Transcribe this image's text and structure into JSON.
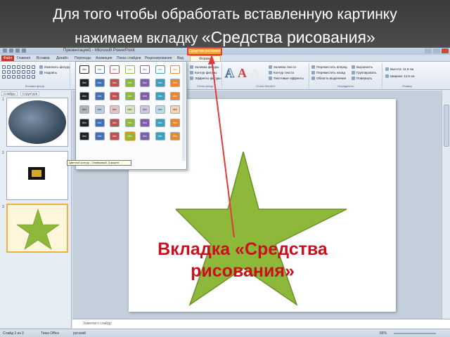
{
  "caption": {
    "line1": "Для того чтобы обработать  вставленную картинку",
    "line2_prefix": "нажимаем вкладку ",
    "line2_tab": "«Средства рисования»"
  },
  "titlebar": {
    "doc_title": "Презентация1 - Microsoft PowerPoint",
    "context_tab_head": "Средства рисования"
  },
  "ribbon_tabs": {
    "file": "Файл",
    "tabs": [
      "Главная",
      "Вставка",
      "Дизайн",
      "Переходы",
      "Анимация",
      "Показ слайдов",
      "Рецензирование",
      "Вид"
    ],
    "active": "Формат"
  },
  "ribbon": {
    "groups": {
      "insert_shapes": "Вставка фигур",
      "shape_styles": "Стили фигур",
      "wordart_styles": "Стили WordArt",
      "arrange": "Упорядочить",
      "size": "Размер"
    },
    "items": {
      "change_shape": "Изменить фигуру",
      "text_box": "Надпись",
      "shape_fill": "Заливка фигуры",
      "shape_outline": "Контур фигуры",
      "shape_effects": "Эффекты фигуры",
      "text_fill": "Заливка текста",
      "text_outline": "Контур текста",
      "text_effects": "Текстовые эффекты",
      "bring_forward": "Переместить вперед",
      "send_backward": "Переместить назад",
      "selection_pane": "Область выделения",
      "align": "Выровнять",
      "group": "Группировать",
      "rotate": "Повернуть",
      "height_label": "Высота:",
      "height_value": "11,9 см",
      "width_label": "Ширина:",
      "width_value": "12,5 см"
    },
    "wordart_letters": [
      "A",
      "A",
      "A"
    ]
  },
  "left_pane": {
    "tabs": [
      "Слайды",
      "Структура"
    ],
    "slide_numbers": [
      "1",
      "2",
      "3"
    ]
  },
  "gallery": {
    "swatch_text": "Abc",
    "tooltip": "Цветной контур - Оливковый, 3 акцент"
  },
  "notes": {
    "placeholder": "Заметки к слайду"
  },
  "status": {
    "slide_counter": "Слайд 3 из 3",
    "theme": "Тема Office",
    "language": "русский",
    "zoom": "66%"
  },
  "annotation": {
    "line1": "Вкладка «Средства",
    "line2": "рисования»"
  },
  "colors": {
    "annotation_red": "#c8101e",
    "star_green": "#8db83a",
    "context_tab_orange": "#f0a830"
  }
}
